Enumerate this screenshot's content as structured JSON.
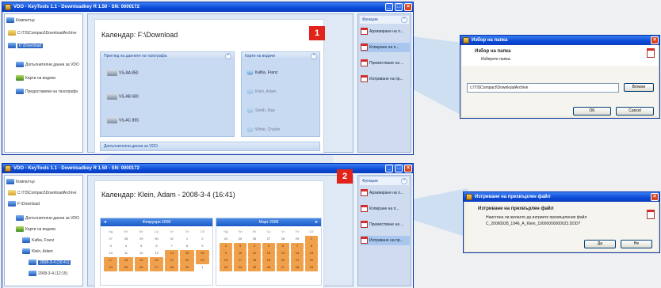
{
  "win1": {
    "title": "VDO - KeyTools 1.1 - Downloadkey R 1.50 - SN: 0000172"
  },
  "win2": {
    "title": "VDO - KeyTools 1.1 - Downloadkey R 1.50 - SN: 0000172"
  },
  "tree1": [
    {
      "label": "Компютър"
    },
    {
      "label": "C:\\TISCompact\\DownloadArchive"
    },
    {
      "label": "F:\\Download"
    },
    {
      "label": "Допълнителни данни за VDO"
    },
    {
      "label": "Карти на водачи"
    },
    {
      "label": "Предоставяни на тахографа"
    }
  ],
  "tree2": [
    {
      "label": "Компютър"
    },
    {
      "label": "C:\\TISCompact\\DownloadArchive"
    },
    {
      "label": "F:\\Download"
    },
    {
      "label": "Допълнителни данни за VDO"
    },
    {
      "label": "Карти на водачи"
    },
    {
      "label": "Kafka, Franz"
    },
    {
      "label": "Klein, Adam"
    },
    {
      "label": "2008-3-4 (16:41)"
    },
    {
      "label": "2008-3-4 (12:15)"
    }
  ],
  "main1": {
    "heading": "Календар: F:\\Download",
    "sect_scans": "Преглед на данните на тахографа",
    "scans": [
      "VS-AA 850",
      "VS-AB 680",
      "VS-AC 855"
    ],
    "sect_drivers": "Карти на водачи",
    "drivers": [
      "Kafka, Franz",
      "Klein, Adam",
      "Smith, Max",
      "White, Charlie"
    ],
    "sect_extra": "Допълнителни данни за VDO"
  },
  "main2": {
    "heading": "Календар: Klein, Adam   -   2008-3-4 (16:41)",
    "cal1": {
      "month": "Февруари 2008"
    },
    "cal2": {
      "month": "Март 2008"
    },
    "weekdays": [
      "Нд",
      "Пн",
      "Вт",
      "Ср",
      "Чт",
      "Пт",
      "Сб"
    ]
  },
  "tasks": {
    "header": "Функции",
    "items": [
      "Архивиране на п...",
      "Копиране на п...",
      "Преместване на ...",
      "Изтриване на пр..."
    ]
  },
  "badges": {
    "one": "1",
    "two": "2"
  },
  "dlg1": {
    "title": "Избор на папка",
    "heading": "Избор на папка",
    "sub": "Изберете папка.",
    "path": "c:\\TISCompact\\DownloadArchive",
    "browse": "Browse",
    "ok": "OK",
    "cancel": "Cancel"
  },
  "dlg2": {
    "title": "Изтриване на прехвърлен файл",
    "heading": "Изтриване на прехвърлен файл",
    "msg1": "Наистина ли желаете да изтриете прехвърления файл",
    "msg2": "C_20060928_1946_A_Klein_10000000000023.DDD?",
    "yes": "Да",
    "no": "Не"
  },
  "colors": {
    "accent": "#0a49d6",
    "badge": "#e2231a",
    "highlight": "#f0a04a"
  }
}
